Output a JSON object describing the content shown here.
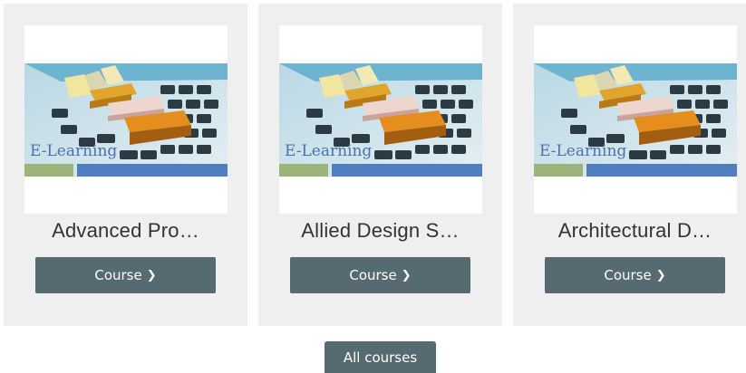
{
  "courses": [
    {
      "title": "Advanced Pro…",
      "thumbnail_text": "E-Learning",
      "button_label": "Course"
    },
    {
      "title": "Allied Design S…",
      "thumbnail_text": "E-Learning",
      "button_label": "Course"
    },
    {
      "title": "Architectural D…",
      "thumbnail_text": "E-Learning",
      "button_label": "Course"
    }
  ],
  "all_courses_label": "All courses",
  "icons": {
    "course_button": "chevron-right-icon"
  },
  "colors": {
    "button_bg": "#566a72",
    "card_bg": "#efefef",
    "elearning_text": "#4a72b0",
    "bar_green": "#9cb37a",
    "bar_blue": "#4f7fc1"
  }
}
